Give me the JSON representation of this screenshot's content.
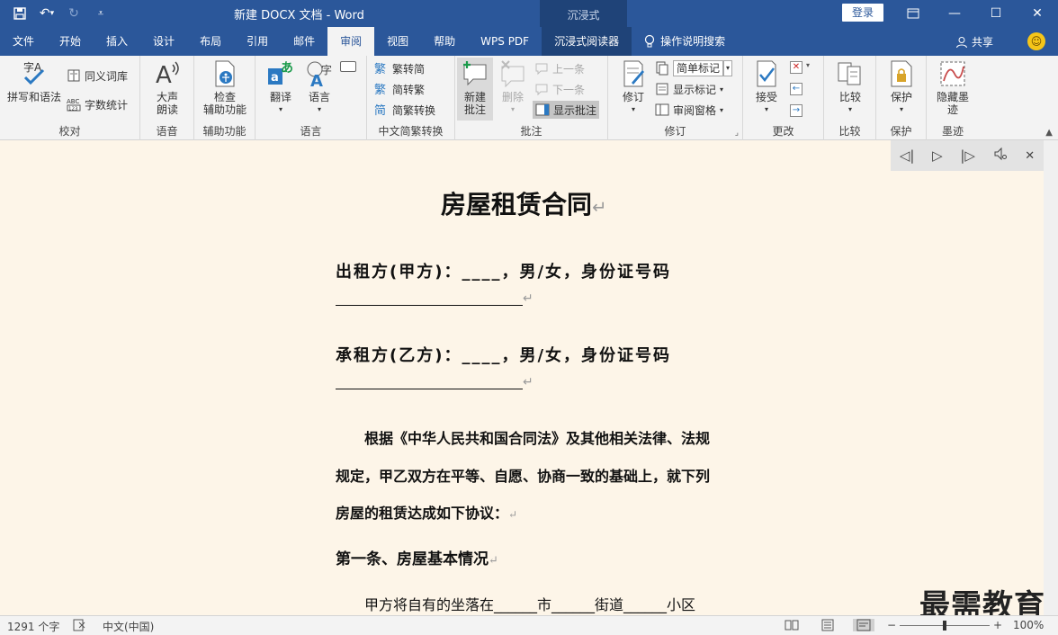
{
  "titlebar": {
    "doc_title": "新建 DOCX 文档  -  Word",
    "immersive_label": "沉浸式",
    "login": "登录"
  },
  "tabs": [
    {
      "label": "文件"
    },
    {
      "label": "开始"
    },
    {
      "label": "插入"
    },
    {
      "label": "设计"
    },
    {
      "label": "布局"
    },
    {
      "label": "引用"
    },
    {
      "label": "邮件"
    },
    {
      "label": "审阅"
    },
    {
      "label": "视图"
    },
    {
      "label": "帮助"
    },
    {
      "label": "WPS PDF"
    },
    {
      "label": "沉浸式阅读器"
    }
  ],
  "active_tab": "审阅",
  "search_tab": "操作说明搜索",
  "share": "共享",
  "ribbon": {
    "proofing": {
      "label": "校对",
      "spelling": "拼写和语法",
      "thesaurus": "同义词库",
      "wordcount": "字数统计"
    },
    "speech": {
      "label": "语音",
      "read_aloud_1": "大声",
      "read_aloud_2": "朗读"
    },
    "accessibility": {
      "label": "辅助功能",
      "check_1": "检查",
      "check_2": "辅助功能"
    },
    "language": {
      "label": "语言",
      "translate": "翻译",
      "language": "语言"
    },
    "chinese": {
      "label": "中文简繁转换",
      "t2s": "繁转简",
      "s2t": "简转繁",
      "convert": "简繁转换"
    },
    "comments": {
      "label": "批注",
      "new_1": "新建",
      "new_2": "批注",
      "delete": "删除",
      "prev": "上一条",
      "next": "下一条",
      "show": "显示批注"
    },
    "tracking": {
      "label": "修订",
      "track": "修订",
      "markup": "简单标记",
      "show_markup": "显示标记",
      "pane": "审阅窗格"
    },
    "changes": {
      "label": "更改",
      "accept": "接受"
    },
    "compare": {
      "label": "比较",
      "compare": "比较"
    },
    "protect": {
      "label": "保护",
      "protect": "保护"
    },
    "ink": {
      "label": "墨迹",
      "hide_1": "隐藏墨",
      "hide_2": "迹"
    }
  },
  "document": {
    "title": "房屋租赁合同",
    "lessor": "出租方(甲方)：____，男/女，身份证号码",
    "lessee": "承租方(乙方)：____，男/女，身份证号码",
    "body_1": "根据《中华人民共和国合同法》及其他相关法律、法规",
    "body_2": "规定，甲乙双方在平等、自愿、协商一致的基础上，就下列",
    "body_3": "房屋的租赁达成如下协议：",
    "article_1": "第一条、房屋基本情况",
    "location": "甲方将自有的坐落在______市______街道______小区"
  },
  "watermark": "最需教育",
  "status": {
    "wordcount": "1291 个字",
    "language": "中文(中国)",
    "zoom": "100%",
    "zoom_level": 1.0
  }
}
